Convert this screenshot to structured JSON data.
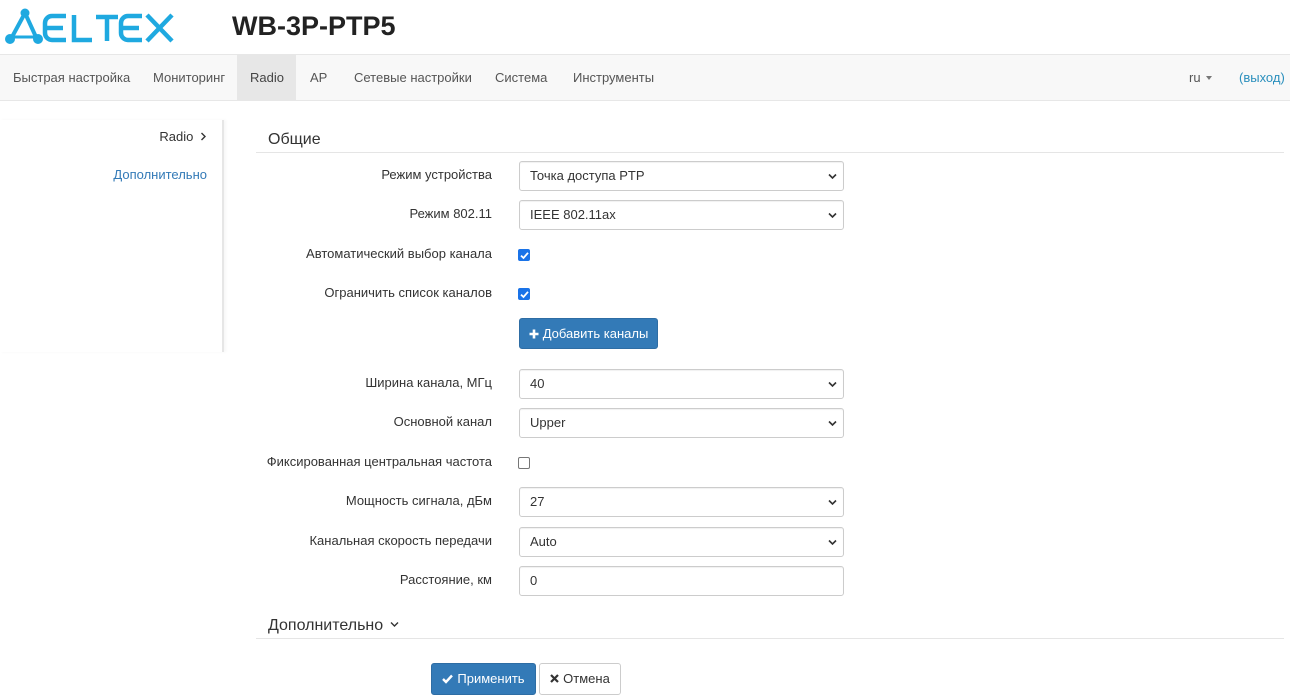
{
  "brand": {
    "logo_text": "ELTEX",
    "logo_color": "#1fa9e0",
    "device_name": "WB-3P-PTP5"
  },
  "navbar": {
    "items": [
      {
        "label": "Быстрая настройка",
        "active": false
      },
      {
        "label": "Мониторинг",
        "active": false
      },
      {
        "label": "Radio",
        "active": true
      },
      {
        "label": "AP",
        "active": false
      },
      {
        "label": "Сетевые настройки",
        "active": false
      },
      {
        "label": "Система",
        "active": false
      },
      {
        "label": "Инструменты",
        "active": false
      }
    ],
    "language": "ru",
    "logout": "(выход)"
  },
  "sidebar": {
    "current": "Radio",
    "link": "Дополнительно"
  },
  "sections": {
    "general": "Общие",
    "advanced": "Дополнительно"
  },
  "form": {
    "device_mode": {
      "label": "Режим устройства",
      "value": "Точка доступа PTP"
    },
    "mode_80211": {
      "label": "Режим 802.11",
      "value": "IEEE 802.11ax"
    },
    "auto_channel": {
      "label": "Автоматический выбор канала",
      "checked": true
    },
    "limit_channels": {
      "label": "Ограничить список каналов",
      "checked": true
    },
    "add_channels_button": "Добавить каналы",
    "channel_width": {
      "label": "Ширина канала, МГц",
      "value": "40"
    },
    "primary_channel": {
      "label": "Основной канал",
      "value": "Upper"
    },
    "fixed_center_freq": {
      "label": "Фиксированная центральная частота",
      "checked": false
    },
    "tx_power": {
      "label": "Мощность сигнала, дБм",
      "value": "27"
    },
    "channel_rate": {
      "label": "Канальная скорость передачи",
      "value": "Auto"
    },
    "distance": {
      "label": "Расстояние, км",
      "value": "0"
    }
  },
  "actions": {
    "apply": "Применить",
    "cancel": "Отмена"
  },
  "colors": {
    "primary": "#337ab7",
    "link": "#337ab7",
    "logout_link": "#2a8fbd",
    "checkbox": "#1a73e8"
  }
}
